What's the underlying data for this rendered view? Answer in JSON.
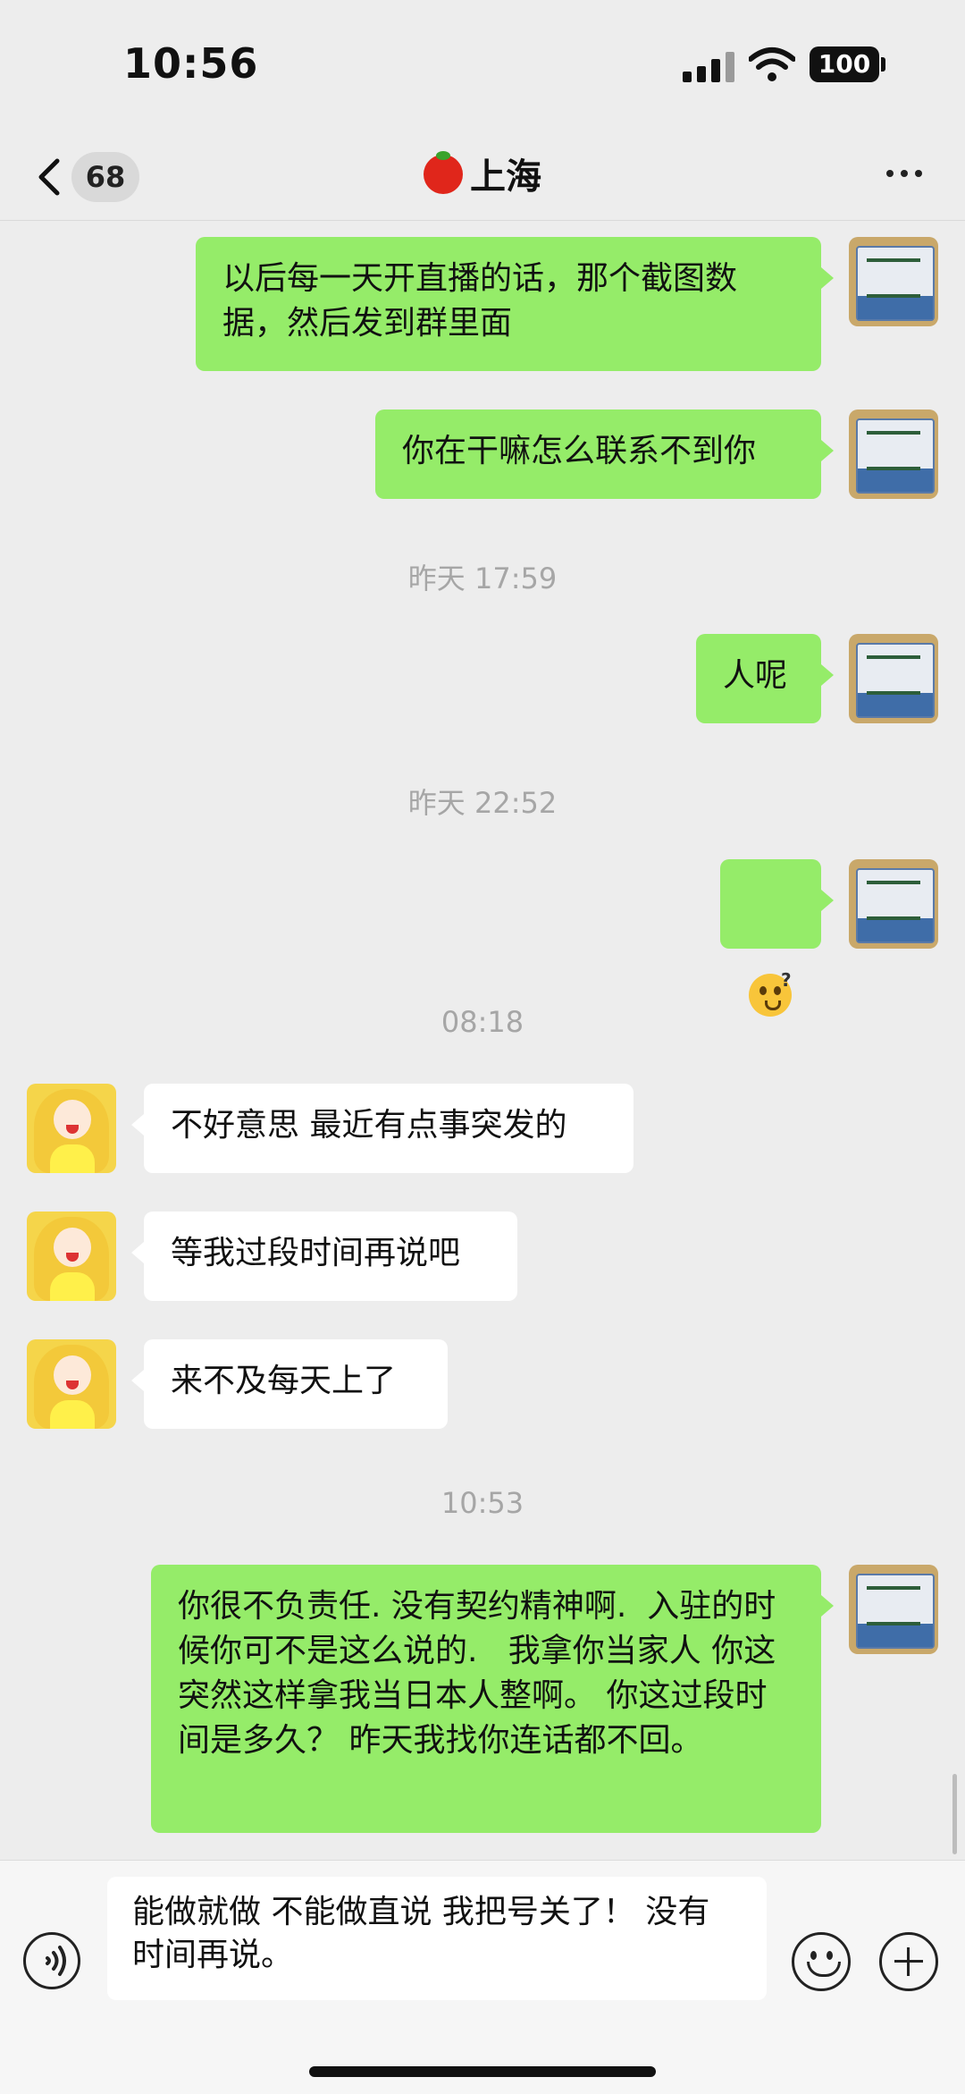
{
  "status_bar": {
    "time": "10:56",
    "battery": "100"
  },
  "nav": {
    "unread_count": "68",
    "title": "上海",
    "title_emoji_icon": "tomato-icon"
  },
  "messages": [
    {
      "sender": "self",
      "text": "以后每一天开直播的话，那个截图数据，然后发到群里面"
    },
    {
      "sender": "self",
      "text": "你在干嘛怎么联系不到你"
    },
    {
      "sender": "self",
      "text": "人呢"
    },
    {
      "sender": "self",
      "emoji": "confused-face-emoji"
    },
    {
      "sender": "other",
      "text": "不好意思 最近有点事突发的"
    },
    {
      "sender": "other",
      "text": "等我过段时间再说吧"
    },
    {
      "sender": "other",
      "text": "来不及每天上了"
    },
    {
      "sender": "self",
      "text": "你很不负责任. 没有契约精神啊.  入驻的时候你可不是这么说的.   我拿你当家人 你这突然这样拿我当日本人整啊。 你这过段时间是多久？ 昨天我找你连话都不回。"
    }
  ],
  "timestamps": [
    "昨天 17:59",
    "昨天 22:52",
    "08:18",
    "10:53"
  ],
  "input": {
    "draft": "能做就做  不能做直说  我把号关了！ 没有时间再说。"
  },
  "colors": {
    "self_bubble": "#95ec69",
    "other_bubble": "#ffffff",
    "background": "#ededed"
  }
}
